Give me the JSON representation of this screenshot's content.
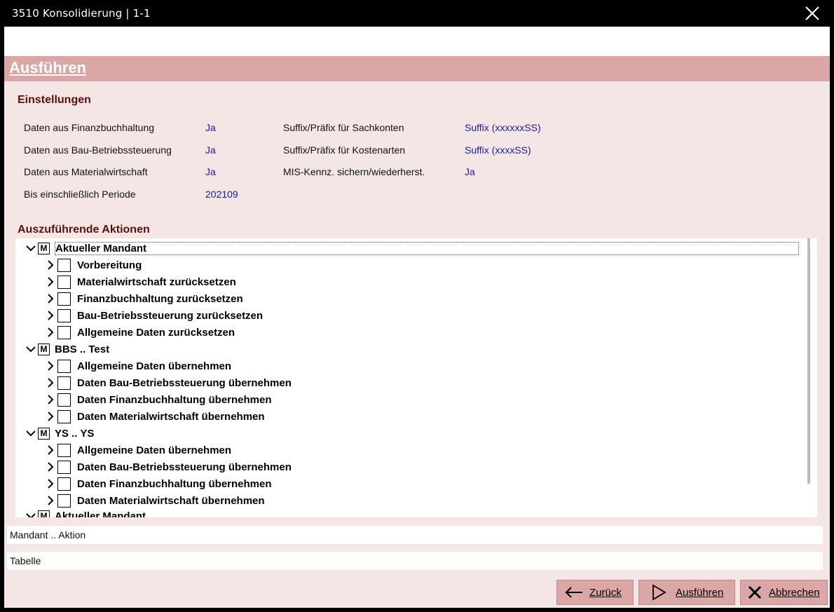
{
  "window": {
    "title": "3510 Konsolidierung | 1-1"
  },
  "header": {
    "title": "Ausführen"
  },
  "settings": {
    "title": "Einstellungen",
    "left": [
      {
        "label": "Daten aus Finanzbuchhaltung",
        "value": "Ja"
      },
      {
        "label": "Daten aus Bau-Betriebssteuerung",
        "value": "Ja"
      },
      {
        "label": "Daten aus Materialwirtschaft",
        "value": "Ja"
      },
      {
        "label": "Bis einschließlich Periode",
        "value": "202109"
      }
    ],
    "right": [
      {
        "label": "Suffix/Präfix für Sachkonten",
        "value": "Suffix (xxxxxxSS)"
      },
      {
        "label": "Suffix/Präfix für Kostenarten",
        "value": "Suffix (xxxxSS)"
      },
      {
        "label": "MIS-Kennz. sichern/wiederherst.",
        "value": "Ja"
      }
    ]
  },
  "actions": {
    "title": "Auszuführende Aktionen",
    "mark": "M",
    "rows": [
      {
        "level": 0,
        "label": "Aktueller Mandant",
        "expanded": true
      },
      {
        "level": 1,
        "label": "Vorbereitung",
        "expanded": false
      },
      {
        "level": 1,
        "label": "Materialwirtschaft zurücksetzen",
        "expanded": false
      },
      {
        "level": 1,
        "label": "Finanzbuchhaltung zurücksetzen",
        "expanded": false
      },
      {
        "level": 1,
        "label": "Bau-Betriebssteuerung zurücksetzen",
        "expanded": false
      },
      {
        "level": 1,
        "label": "Allgemeine Daten zurücksetzen",
        "expanded": false
      },
      {
        "level": 0,
        "label": "BBS .. Test",
        "expanded": true
      },
      {
        "level": 1,
        "label": "Allgemeine Daten übernehmen",
        "expanded": false
      },
      {
        "level": 1,
        "label": "Daten Bau-Betriebssteuerung übernehmen",
        "expanded": false
      },
      {
        "level": 1,
        "label": "Daten Finanzbuchhaltung übernehmen",
        "expanded": false
      },
      {
        "level": 1,
        "label": "Daten Materialwirtschaft übernehmen",
        "expanded": false
      },
      {
        "level": 0,
        "label": "YS .. YS",
        "expanded": true
      },
      {
        "level": 1,
        "label": "Allgemeine Daten übernehmen",
        "expanded": false
      },
      {
        "level": 1,
        "label": "Daten Bau-Betriebssteuerung übernehmen",
        "expanded": false
      },
      {
        "level": 1,
        "label": "Daten Finanzbuchhaltung übernehmen",
        "expanded": false
      },
      {
        "level": 1,
        "label": "Daten Materialwirtschaft übernehmen",
        "expanded": false
      },
      {
        "level": 0,
        "label": "Aktueller Mandant",
        "expanded": true
      }
    ]
  },
  "status": {
    "mandant_aktion": "Mandant .. Aktion",
    "tabelle": "Tabelle"
  },
  "buttons": {
    "back": "Zurück",
    "run": "Ausführen",
    "cancel": "Abbrechen"
  },
  "icons": {
    "close": "close-icon",
    "back": "arrow-left-icon",
    "run": "play-icon",
    "cancel": "x-icon",
    "expanded": "chevron-down-icon",
    "collapsed": "chevron-right-icon"
  },
  "colors": {
    "background": "#f5e6e6",
    "header_band": "#dba6a6",
    "section_title": "#5a0f0f",
    "value_text": "#1a1aa8"
  }
}
